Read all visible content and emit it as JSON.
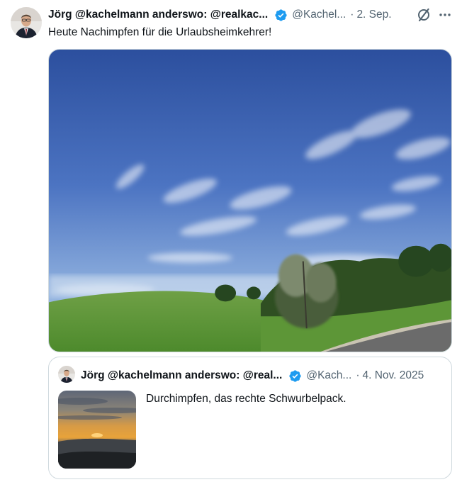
{
  "tweet": {
    "author_name": "Jörg @kachelmann anderswo: @realkac...",
    "handle": "@Kachel...",
    "separator": "·",
    "date": "2. Sep.",
    "text": "Heute Nachimpfen für die Urlaubsheimkehrer!",
    "media": {
      "description": "photo",
      "icon": "photo-landscape"
    },
    "icons": {
      "verified": "verified-badge-icon",
      "grok": "grok-icon",
      "more": "more-icon"
    }
  },
  "quote": {
    "author_name": "Jörg @kachelmann anderswo: @real...",
    "handle": "@Kach...",
    "separator": "·",
    "date": "4. Nov. 2025",
    "text": "Durchimpfen, das rechte Schwurbelpack."
  },
  "colors": {
    "verified": "#1d9bf0",
    "text": "#0f1419",
    "secondary": "#536471",
    "border": "#cfd9de"
  }
}
